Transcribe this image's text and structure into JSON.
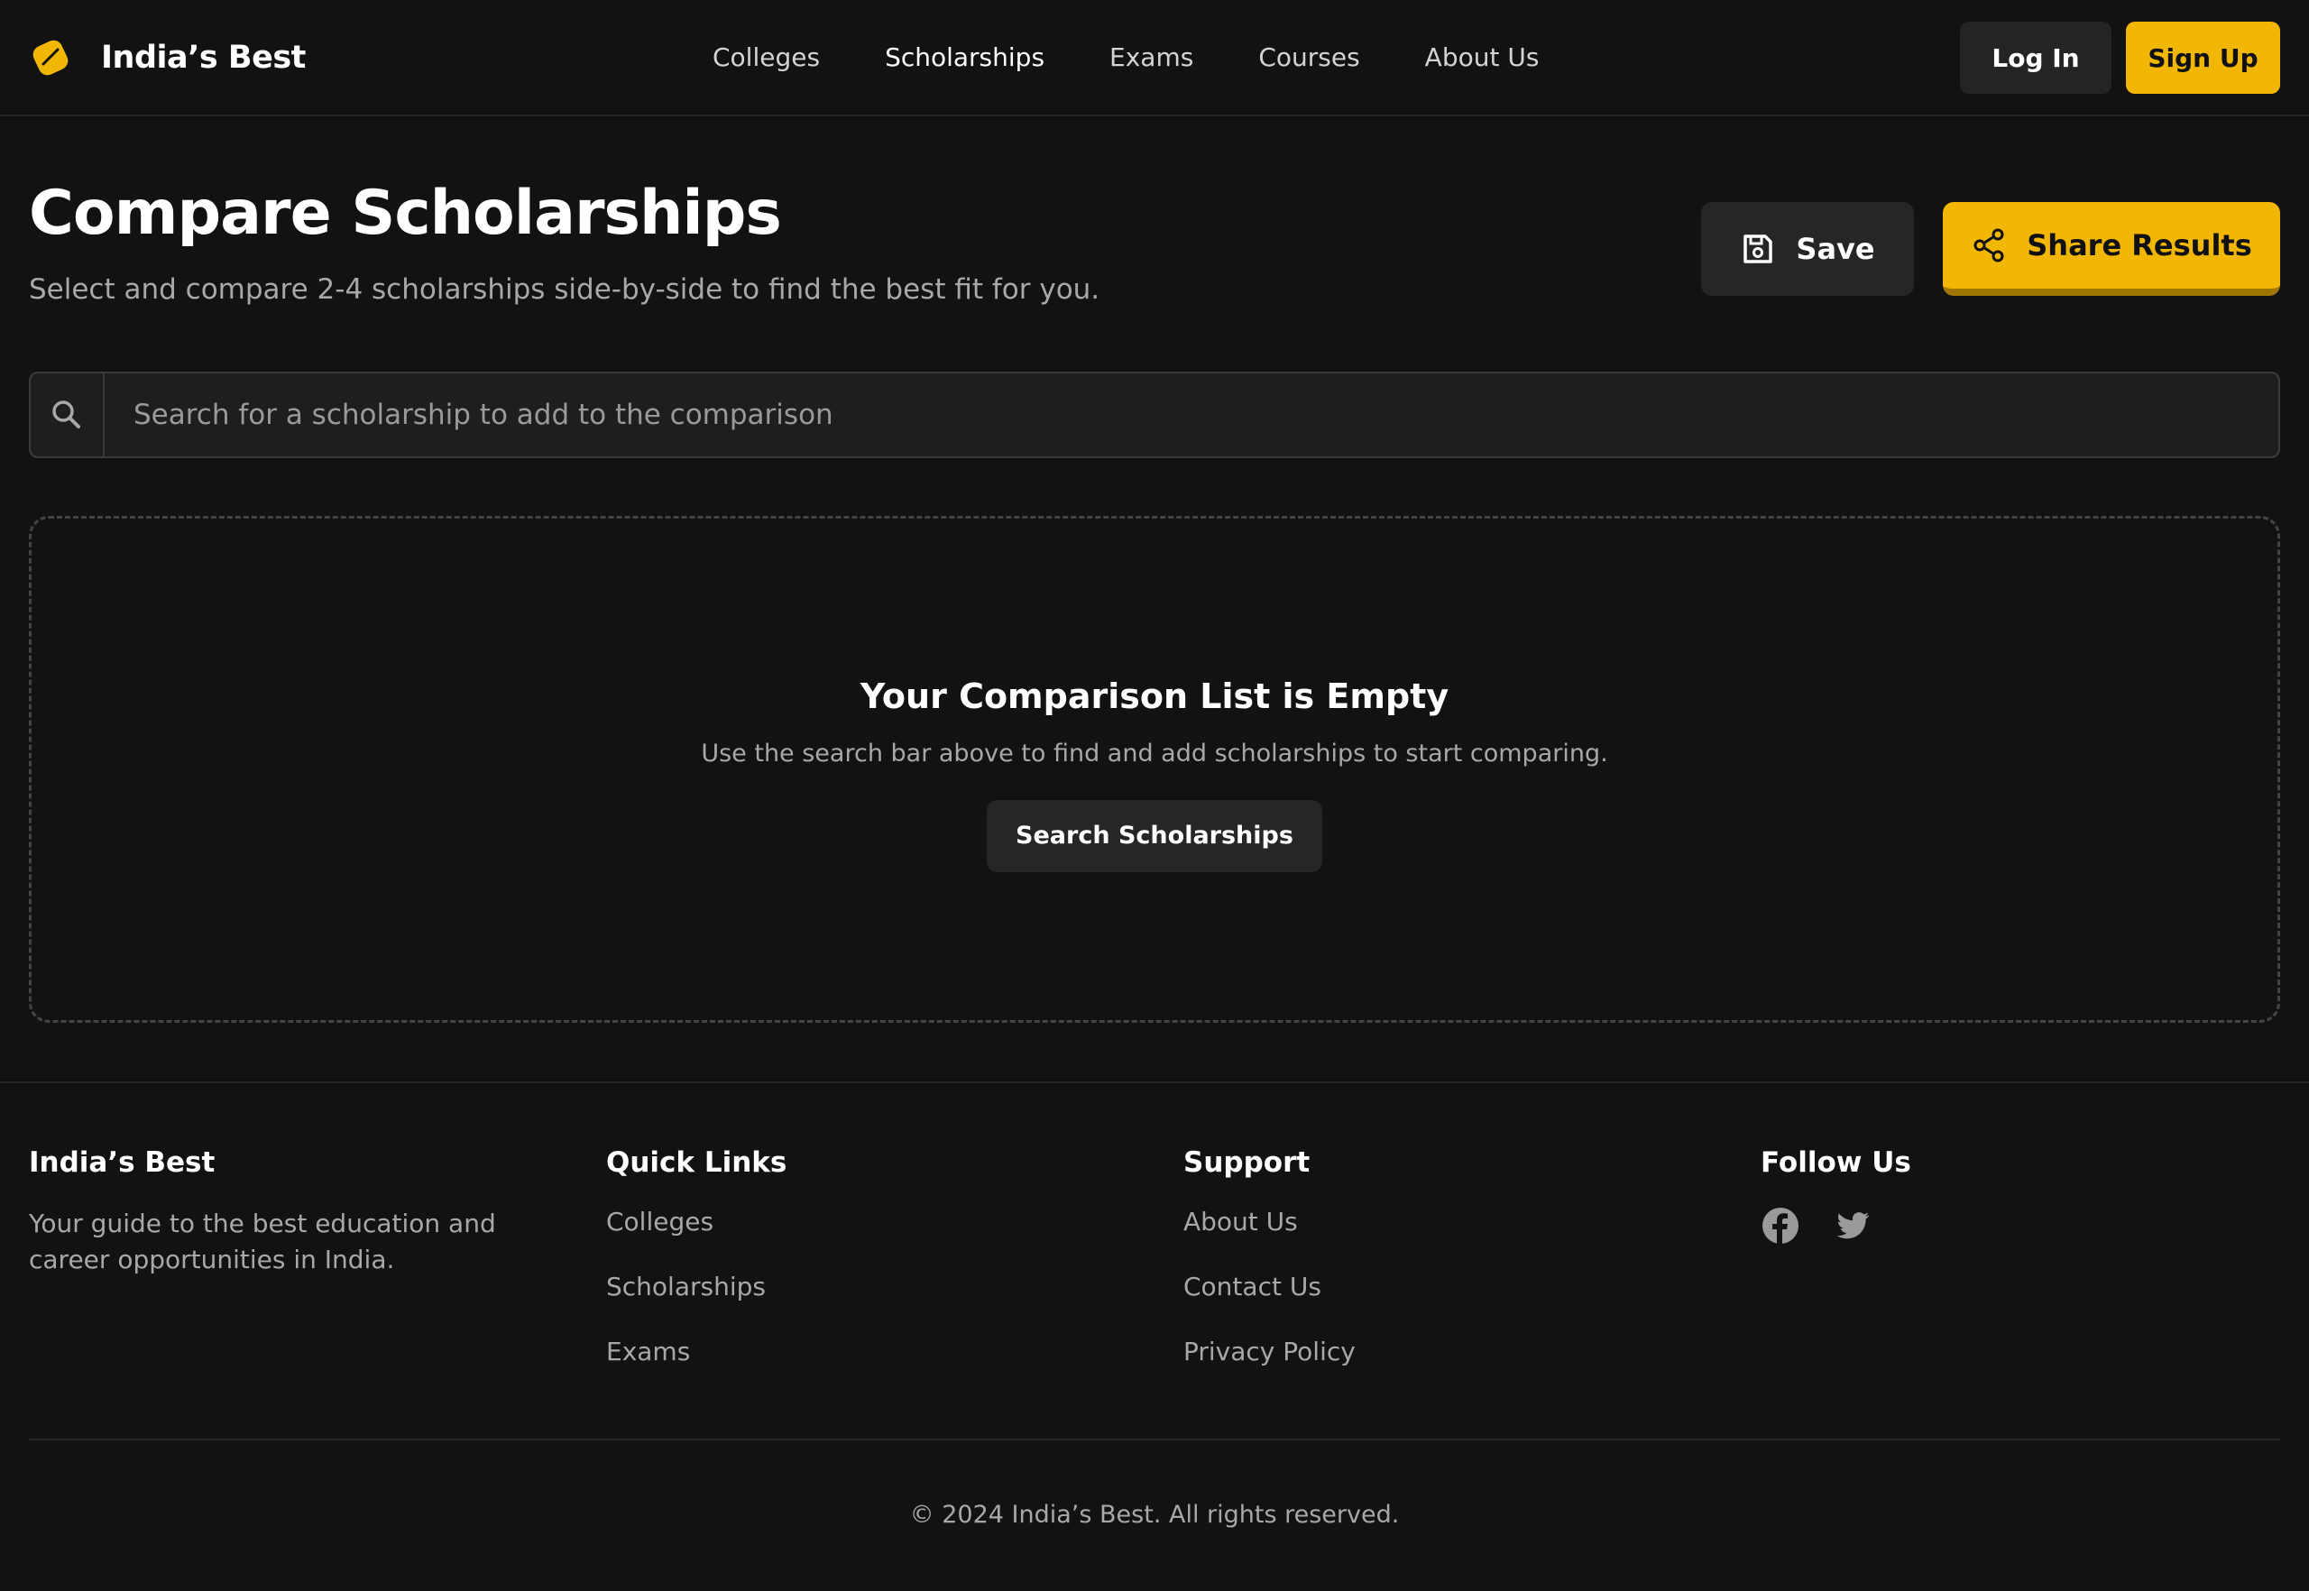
{
  "brand": {
    "name": "India’s Best",
    "accent_color": "#f2b705"
  },
  "nav": {
    "items": [
      {
        "label": "Colleges"
      },
      {
        "label": "Scholarships"
      },
      {
        "label": "Exams"
      },
      {
        "label": "Courses"
      },
      {
        "label": "About Us"
      }
    ],
    "active": "Scholarships"
  },
  "auth": {
    "login_label": "Log In",
    "signup_label": "Sign Up"
  },
  "page": {
    "title": "Compare Scholarships",
    "subtitle": "Select and compare 2-4 scholarships side-by-side to find the best fit for you.",
    "save_label": "Save",
    "share_label": "Share Results"
  },
  "search": {
    "placeholder": "Search for a scholarship to add to the comparison",
    "value": ""
  },
  "empty_state": {
    "title": "Your Comparison List is Empty",
    "description": "Use the search bar above to find and add scholarships to start comparing.",
    "button_label": "Search Scholarships"
  },
  "footer": {
    "about": {
      "heading": "India’s Best",
      "text": "Your guide to the best education and career opportunities in India."
    },
    "quick_links": {
      "heading": "Quick Links",
      "links": [
        "Colleges",
        "Scholarships",
        "Exams"
      ]
    },
    "support": {
      "heading": "Support",
      "links": [
        "About Us",
        "Contact Us",
        "Privacy Policy"
      ]
    },
    "follow": {
      "heading": "Follow Us",
      "icons": [
        "facebook-icon",
        "twitter-icon"
      ]
    },
    "copyright": "© 2024 India’s Best. All rights reserved."
  }
}
